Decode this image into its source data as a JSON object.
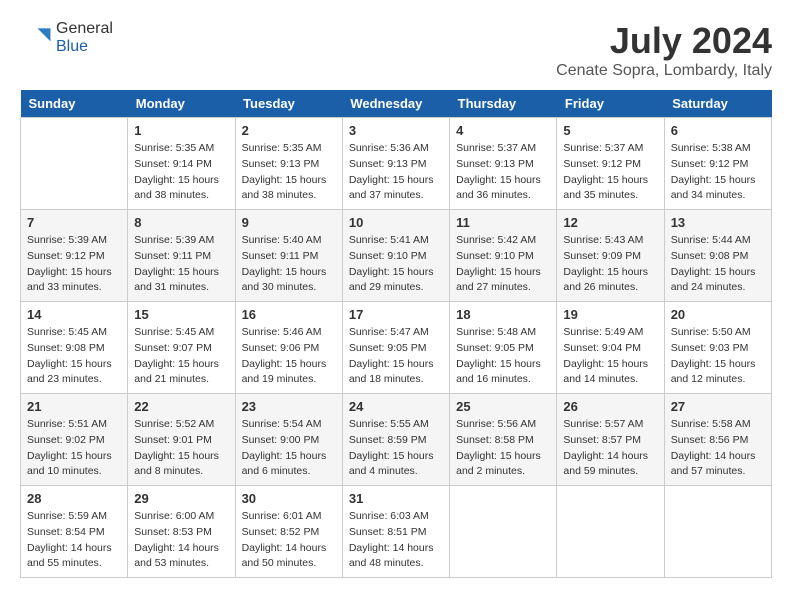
{
  "header": {
    "logo_general": "General",
    "logo_blue": "Blue",
    "month_title": "July 2024",
    "location": "Cenate Sopra, Lombardy, Italy"
  },
  "weekdays": [
    "Sunday",
    "Monday",
    "Tuesday",
    "Wednesday",
    "Thursday",
    "Friday",
    "Saturday"
  ],
  "weeks": [
    [
      {
        "day": "",
        "empty": true
      },
      {
        "day": "1",
        "sunrise": "5:35 AM",
        "sunset": "9:14 PM",
        "daylight": "15 hours and 38 minutes."
      },
      {
        "day": "2",
        "sunrise": "5:35 AM",
        "sunset": "9:13 PM",
        "daylight": "15 hours and 38 minutes."
      },
      {
        "day": "3",
        "sunrise": "5:36 AM",
        "sunset": "9:13 PM",
        "daylight": "15 hours and 37 minutes."
      },
      {
        "day": "4",
        "sunrise": "5:37 AM",
        "sunset": "9:13 PM",
        "daylight": "15 hours and 36 minutes."
      },
      {
        "day": "5",
        "sunrise": "5:37 AM",
        "sunset": "9:12 PM",
        "daylight": "15 hours and 35 minutes."
      },
      {
        "day": "6",
        "sunrise": "5:38 AM",
        "sunset": "9:12 PM",
        "daylight": "15 hours and 34 minutes."
      }
    ],
    [
      {
        "day": "7",
        "sunrise": "5:39 AM",
        "sunset": "9:12 PM",
        "daylight": "15 hours and 33 minutes."
      },
      {
        "day": "8",
        "sunrise": "5:39 AM",
        "sunset": "9:11 PM",
        "daylight": "15 hours and 31 minutes."
      },
      {
        "day": "9",
        "sunrise": "5:40 AM",
        "sunset": "9:11 PM",
        "daylight": "15 hours and 30 minutes."
      },
      {
        "day": "10",
        "sunrise": "5:41 AM",
        "sunset": "9:10 PM",
        "daylight": "15 hours and 29 minutes."
      },
      {
        "day": "11",
        "sunrise": "5:42 AM",
        "sunset": "9:10 PM",
        "daylight": "15 hours and 27 minutes."
      },
      {
        "day": "12",
        "sunrise": "5:43 AM",
        "sunset": "9:09 PM",
        "daylight": "15 hours and 26 minutes."
      },
      {
        "day": "13",
        "sunrise": "5:44 AM",
        "sunset": "9:08 PM",
        "daylight": "15 hours and 24 minutes."
      }
    ],
    [
      {
        "day": "14",
        "sunrise": "5:45 AM",
        "sunset": "9:08 PM",
        "daylight": "15 hours and 23 minutes."
      },
      {
        "day": "15",
        "sunrise": "5:45 AM",
        "sunset": "9:07 PM",
        "daylight": "15 hours and 21 minutes."
      },
      {
        "day": "16",
        "sunrise": "5:46 AM",
        "sunset": "9:06 PM",
        "daylight": "15 hours and 19 minutes."
      },
      {
        "day": "17",
        "sunrise": "5:47 AM",
        "sunset": "9:05 PM",
        "daylight": "15 hours and 18 minutes."
      },
      {
        "day": "18",
        "sunrise": "5:48 AM",
        "sunset": "9:05 PM",
        "daylight": "15 hours and 16 minutes."
      },
      {
        "day": "19",
        "sunrise": "5:49 AM",
        "sunset": "9:04 PM",
        "daylight": "15 hours and 14 minutes."
      },
      {
        "day": "20",
        "sunrise": "5:50 AM",
        "sunset": "9:03 PM",
        "daylight": "15 hours and 12 minutes."
      }
    ],
    [
      {
        "day": "21",
        "sunrise": "5:51 AM",
        "sunset": "9:02 PM",
        "daylight": "15 hours and 10 minutes."
      },
      {
        "day": "22",
        "sunrise": "5:52 AM",
        "sunset": "9:01 PM",
        "daylight": "15 hours and 8 minutes."
      },
      {
        "day": "23",
        "sunrise": "5:54 AM",
        "sunset": "9:00 PM",
        "daylight": "15 hours and 6 minutes."
      },
      {
        "day": "24",
        "sunrise": "5:55 AM",
        "sunset": "8:59 PM",
        "daylight": "15 hours and 4 minutes."
      },
      {
        "day": "25",
        "sunrise": "5:56 AM",
        "sunset": "8:58 PM",
        "daylight": "15 hours and 2 minutes."
      },
      {
        "day": "26",
        "sunrise": "5:57 AM",
        "sunset": "8:57 PM",
        "daylight": "14 hours and 59 minutes."
      },
      {
        "day": "27",
        "sunrise": "5:58 AM",
        "sunset": "8:56 PM",
        "daylight": "14 hours and 57 minutes."
      }
    ],
    [
      {
        "day": "28",
        "sunrise": "5:59 AM",
        "sunset": "8:54 PM",
        "daylight": "14 hours and 55 minutes."
      },
      {
        "day": "29",
        "sunrise": "6:00 AM",
        "sunset": "8:53 PM",
        "daylight": "14 hours and 53 minutes."
      },
      {
        "day": "30",
        "sunrise": "6:01 AM",
        "sunset": "8:52 PM",
        "daylight": "14 hours and 50 minutes."
      },
      {
        "day": "31",
        "sunrise": "6:03 AM",
        "sunset": "8:51 PM",
        "daylight": "14 hours and 48 minutes."
      },
      {
        "day": "",
        "empty": true
      },
      {
        "day": "",
        "empty": true
      },
      {
        "day": "",
        "empty": true
      }
    ]
  ]
}
